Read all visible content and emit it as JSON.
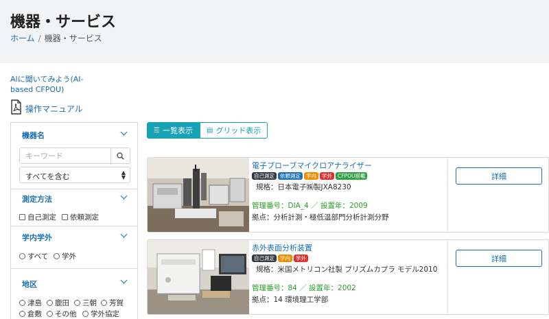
{
  "page": {
    "title": "機器・サービス"
  },
  "breadcrumb": {
    "home": "ホーム",
    "separator": "/",
    "current": "機器・サービス"
  },
  "ai_link": {
    "label": "AIに聞いてみよう(AI-based CFPOU)"
  },
  "manual": {
    "label": "操作マニュアル",
    "icon": "pdf-icon"
  },
  "sidebar": {
    "equipment": {
      "title": "機器名",
      "keyword_placeholder": "キーワード",
      "search_icon": "search-icon",
      "match_selected": "すべてを含む"
    },
    "method": {
      "title": "測定方法",
      "options": [
        "自己測定",
        "依頼測定"
      ]
    },
    "campus": {
      "title": "学内学外",
      "options": [
        "すべて",
        "学外"
      ]
    },
    "area": {
      "title": "地区",
      "options": [
        "津島",
        "鹿田",
        "三朝",
        "芳賀",
        "倉敷",
        "その他",
        "学外協定"
      ]
    }
  },
  "view_toggle": {
    "list": {
      "label": "一覧表示",
      "icon": "list-icon"
    },
    "grid": {
      "label": "グリッド表示",
      "icon": "grid-icon"
    }
  },
  "colors": {
    "accent": "#17a2b8",
    "link": "#1a6fb5",
    "green": "#2ca02c",
    "badge_self": "#343a40",
    "badge_request": "#1a6fb5",
    "badge_internal": "#f08c00",
    "badge_external": "#e03131",
    "badge_cfpou": "#2f9e44"
  },
  "equipment": [
    {
      "title": "電子プローブマイクロアナライザー",
      "badges": [
        "自己測定",
        "依頼測定",
        "学内",
        "学外",
        "CFPOU搭載"
      ],
      "spec": "規格：日本電子㈱製JXA8230",
      "management": "管理番号：DIA_4 ／ 設置年：2009",
      "location": "拠点：分析計測・極低温部門分析計測分野",
      "detail_label": "詳細"
    },
    {
      "title": "赤外表面分析装置",
      "badges": [
        "自己測定",
        "学内",
        "学外"
      ],
      "spec": "規格：米国メトリコン社製 プリズムカプラ モデル2010",
      "management": "管理番号：84 ／ 設置年：2002",
      "location": "拠点：14 環境理工学部",
      "detail_label": "詳細"
    }
  ]
}
